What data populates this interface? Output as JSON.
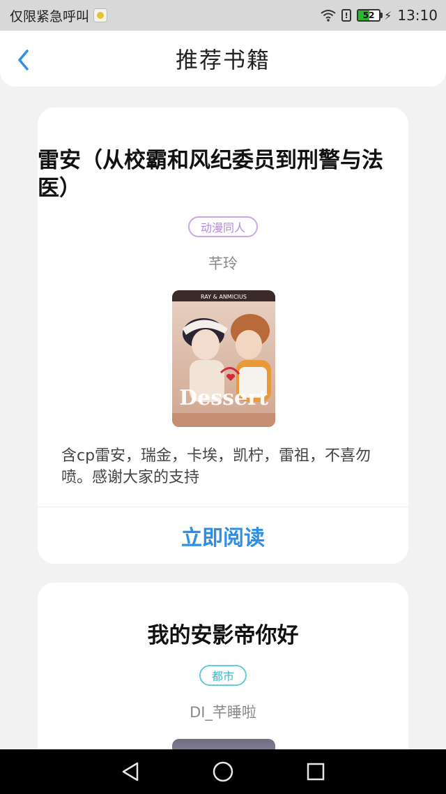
{
  "status_bar": {
    "carrier_text": "仅限紧急呼叫",
    "battery_level": "52",
    "time": "13:10"
  },
  "header": {
    "title": "推荐书籍",
    "back_icon": "chevron-left-icon"
  },
  "books": [
    {
      "title": "雷安（从校霸和风纪委员到刑警与法医）",
      "genre": "动漫同人",
      "genre_color": "#c9a6e6",
      "author": "芊玲",
      "cover_text": "RAY & ANMICIUS",
      "cover_word": "Dessert",
      "description": "含cp雷安，瑞金，卡埃，凯柠，雷祖，不喜勿喷。感谢大家的支持",
      "read_label": "立即阅读"
    },
    {
      "title": "我的安影帝你好",
      "genre": "都市",
      "genre_color": "#5fd0d8",
      "author": "DI_芊睡啦"
    }
  ],
  "colors": {
    "accent": "#2e8fe6",
    "background": "#f2f2f2"
  }
}
